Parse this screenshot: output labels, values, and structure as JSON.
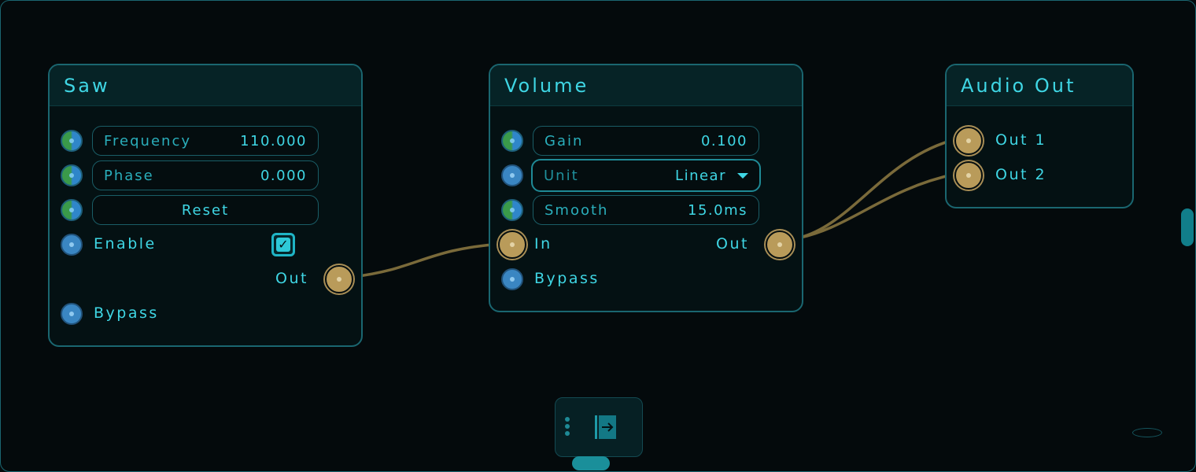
{
  "nodes": {
    "saw": {
      "title": "Saw",
      "params": [
        {
          "label": "Frequency",
          "value": "110.000"
        },
        {
          "label": "Phase",
          "value": "0.000"
        }
      ],
      "reset_label": "Reset",
      "enable_label": "Enable",
      "enable_checked": true,
      "out_label": "Out",
      "bypass_label": "Bypass"
    },
    "volume": {
      "title": "Volume",
      "gain": {
        "label": "Gain",
        "value": "0.100"
      },
      "unit": {
        "label": "Unit",
        "value": "Linear"
      },
      "smooth": {
        "label": "Smooth",
        "value": "15.0ms"
      },
      "in_label": "In",
      "out_label": "Out",
      "bypass_label": "Bypass"
    },
    "audio_out": {
      "title": "Audio Out",
      "outputs": [
        "Out 1",
        "Out 2"
      ]
    }
  },
  "toolbar": {
    "exit_icon": "exit-icon",
    "menu_icon": "vertical-dots-icon"
  },
  "colors": {
    "accent": "#2ec9d8",
    "wire": "#7a6a3a",
    "audio_port": "#b99b5a",
    "node_border": "#1a6670",
    "background": "#040a0c"
  }
}
